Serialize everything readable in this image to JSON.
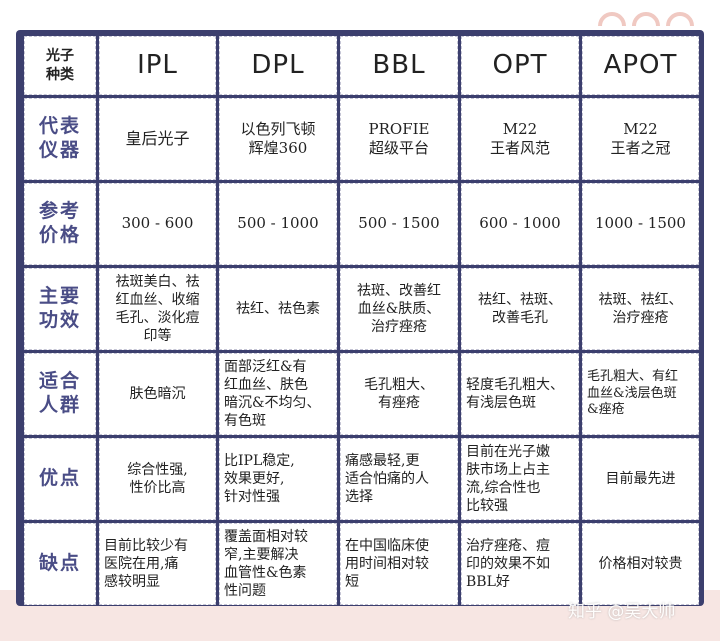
{
  "colors": {
    "frame": "#3c3f6e",
    "row_header_text": "#4a4d86",
    "background_bottom": "#f7e6e3",
    "ring_stroke": "#f0c9c2"
  },
  "table": {
    "corner": "光子\n种类",
    "columns": [
      "IPL",
      "DPL",
      "BBL",
      "OPT",
      "APOT"
    ],
    "rows": [
      {
        "label": "代表\n仪器",
        "cells": [
          "皇后光子",
          "以色列飞顿\n辉煌360",
          "PROFIE\n超级平台",
          "M22\n王者风范",
          "M22\n王者之冠"
        ]
      },
      {
        "label": "参考\n价格",
        "cells": [
          "300 - 600",
          "500 - 1000",
          "500 - 1500",
          "600 - 1000",
          "1000 - 1500"
        ]
      },
      {
        "label": "主要\n功效",
        "cells": [
          "祛斑美白、祛\n红血丝、收缩\n毛孔、淡化痘\n印等",
          "祛红、祛色素",
          "祛斑、改善红\n血丝&肤质、\n治疗痤疮",
          "祛红、祛斑、\n改善毛孔",
          "祛斑、祛红、\n治疗痤疮"
        ]
      },
      {
        "label": "适合\n人群",
        "cells": [
          "肤色暗沉",
          "面部泛红&有\n红血丝、肤色\n暗沉&不均匀、\n有色斑",
          "毛孔粗大、\n有痤疮",
          "轻度毛孔粗大、\n有浅层色斑",
          "毛孔粗大、有红\n血丝&浅层色斑\n&痤疮"
        ]
      },
      {
        "label": "优点",
        "cells": [
          "综合性强,\n性价比高",
          "比IPL稳定,\n效果更好,\n针对性强",
          "痛感最轻,更\n适合怕痛的人\n选择",
          "目前在光子嫩\n肤市场上占主\n流,综合性也\n比较强",
          "目前最先进"
        ]
      },
      {
        "label": "缺点",
        "cells": [
          "目前比较少有\n医院在用,痛\n感较明显",
          "覆盖面相对较\n窄,主要解决\n血管性&色素\n性问题",
          "在中国临床使\n用时间相对较\n短",
          "治疗痤疮、痘\n印的效果不如\nBBL好",
          "价格相对较贵"
        ]
      }
    ]
  },
  "watermark": "知乎 @吴大帅"
}
